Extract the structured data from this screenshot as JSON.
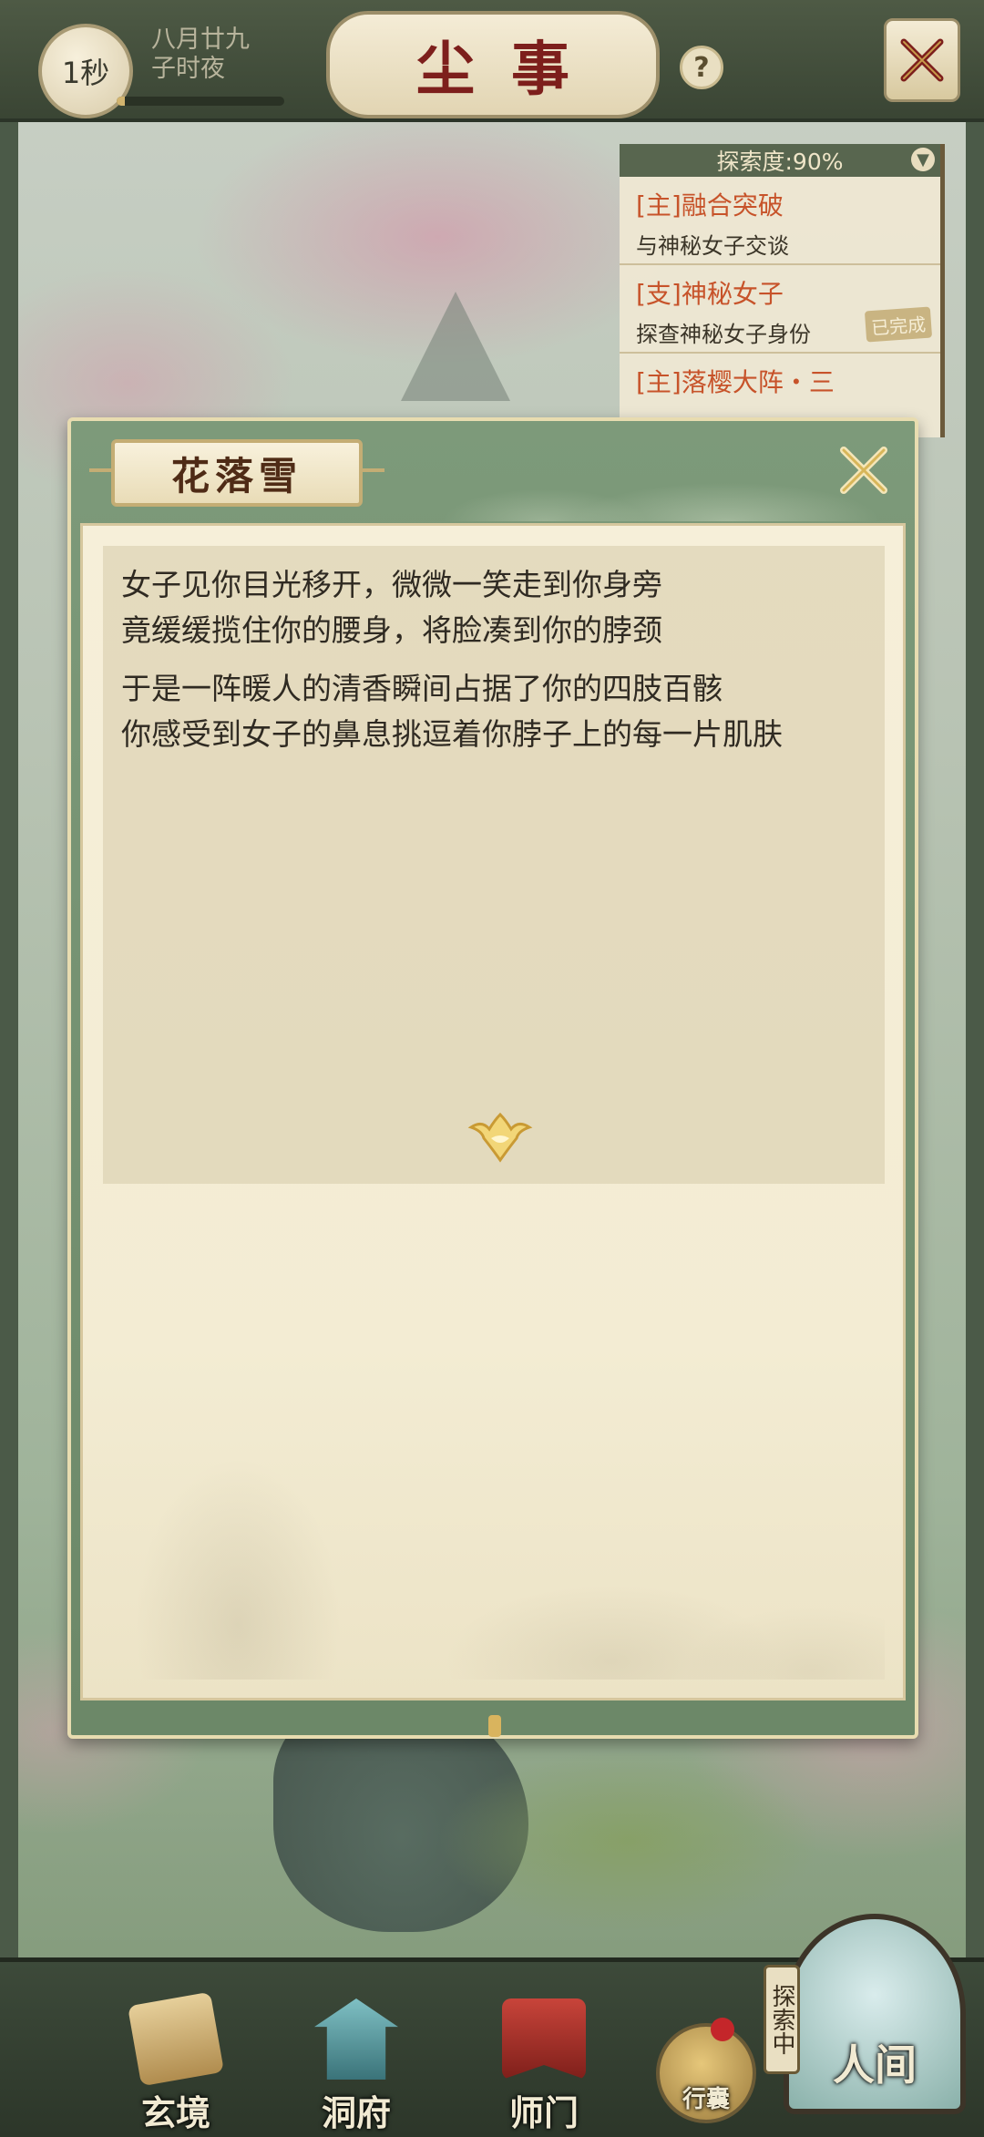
{
  "topbar": {
    "speed_label": "1秒",
    "date_line1": "八月廿九",
    "date_line2": "子时夜",
    "day_progress": 0.05,
    "title": "尘事",
    "help_label": "?"
  },
  "quest_panel": {
    "exploration_label": "探索度:90%",
    "quests": [
      {
        "title": "[主]融合突破",
        "desc": "与神秘女子交谈",
        "stamp": ""
      },
      {
        "title": "[支]神秘女子",
        "desc": "探查神秘女子身份",
        "stamp": "已完成"
      },
      {
        "title": "[主]落樱大阵・三",
        "desc": "",
        "stamp": ""
      }
    ]
  },
  "dialog": {
    "speaker": "花落雪",
    "paragraphs": [
      {
        "line1": "女子见你目光移开，微微一笑走到你身旁",
        "line2": "竟缓缓揽住你的腰身，将脸凑到你的脖颈"
      },
      {
        "line1": "于是一阵暖人的清香瞬间占据了你的四肢百骸",
        "line2": "你感受到女子的鼻息挑逗着你脖子上的每一片肌肤"
      }
    ]
  },
  "nav": {
    "items": [
      {
        "label": "玄境",
        "icon": "scroll-icon",
        "color": "#c9a86a"
      },
      {
        "label": "洞府",
        "icon": "pavilion-icon",
        "color": "#4f8f95"
      },
      {
        "label": "师门",
        "icon": "banner-icon",
        "color": "#a3322b"
      }
    ],
    "bag_label": "行囊",
    "world_label": "人间",
    "exploring_label": "探索中"
  },
  "colors": {
    "title_red": "#7d1f1c",
    "quest_title": "#c7532a",
    "dialog_green": "#7d9a7a",
    "parchment": "#f6efd9"
  }
}
